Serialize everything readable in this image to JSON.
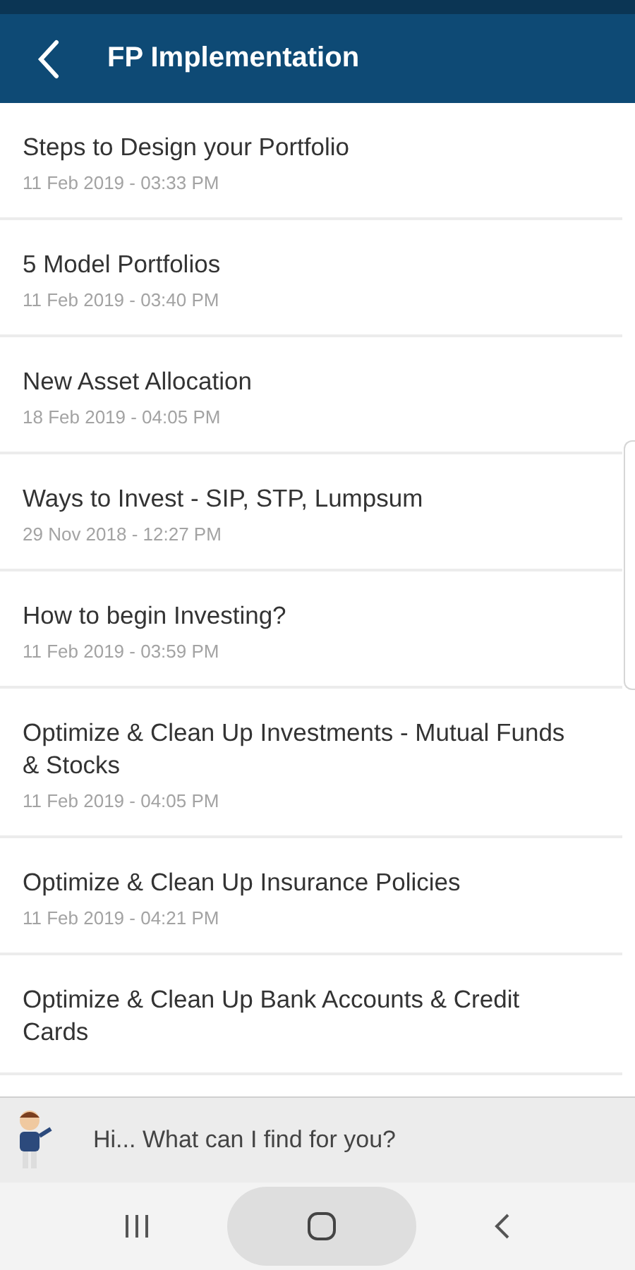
{
  "header": {
    "title": "FP Implementation"
  },
  "items": [
    {
      "title": "Steps to Design your Portfolio",
      "date": "11 Feb 2019 - 03:33 PM"
    },
    {
      "title": "5 Model Portfolios",
      "date": "11 Feb 2019 - 03:40 PM"
    },
    {
      "title": "New Asset Allocation",
      "date": "18 Feb 2019 - 04:05 PM"
    },
    {
      "title": "Ways to Invest - SIP, STP, Lumpsum",
      "date": "29 Nov 2018 - 12:27 PM"
    },
    {
      "title": "How to begin Investing?",
      "date": "11 Feb 2019 - 03:59 PM"
    },
    {
      "title": "Optimize & Clean Up Investments - Mutual Funds & Stocks",
      "date": "11 Feb 2019 - 04:05 PM"
    },
    {
      "title": "Optimize & Clean Up Insurance Policies",
      "date": "11 Feb 2019 - 04:21 PM"
    },
    {
      "title": "Optimize & Clean Up Bank Accounts & Credit Cards"
    }
  ],
  "assistant": {
    "placeholder": "Hi... What can I find for you?"
  }
}
